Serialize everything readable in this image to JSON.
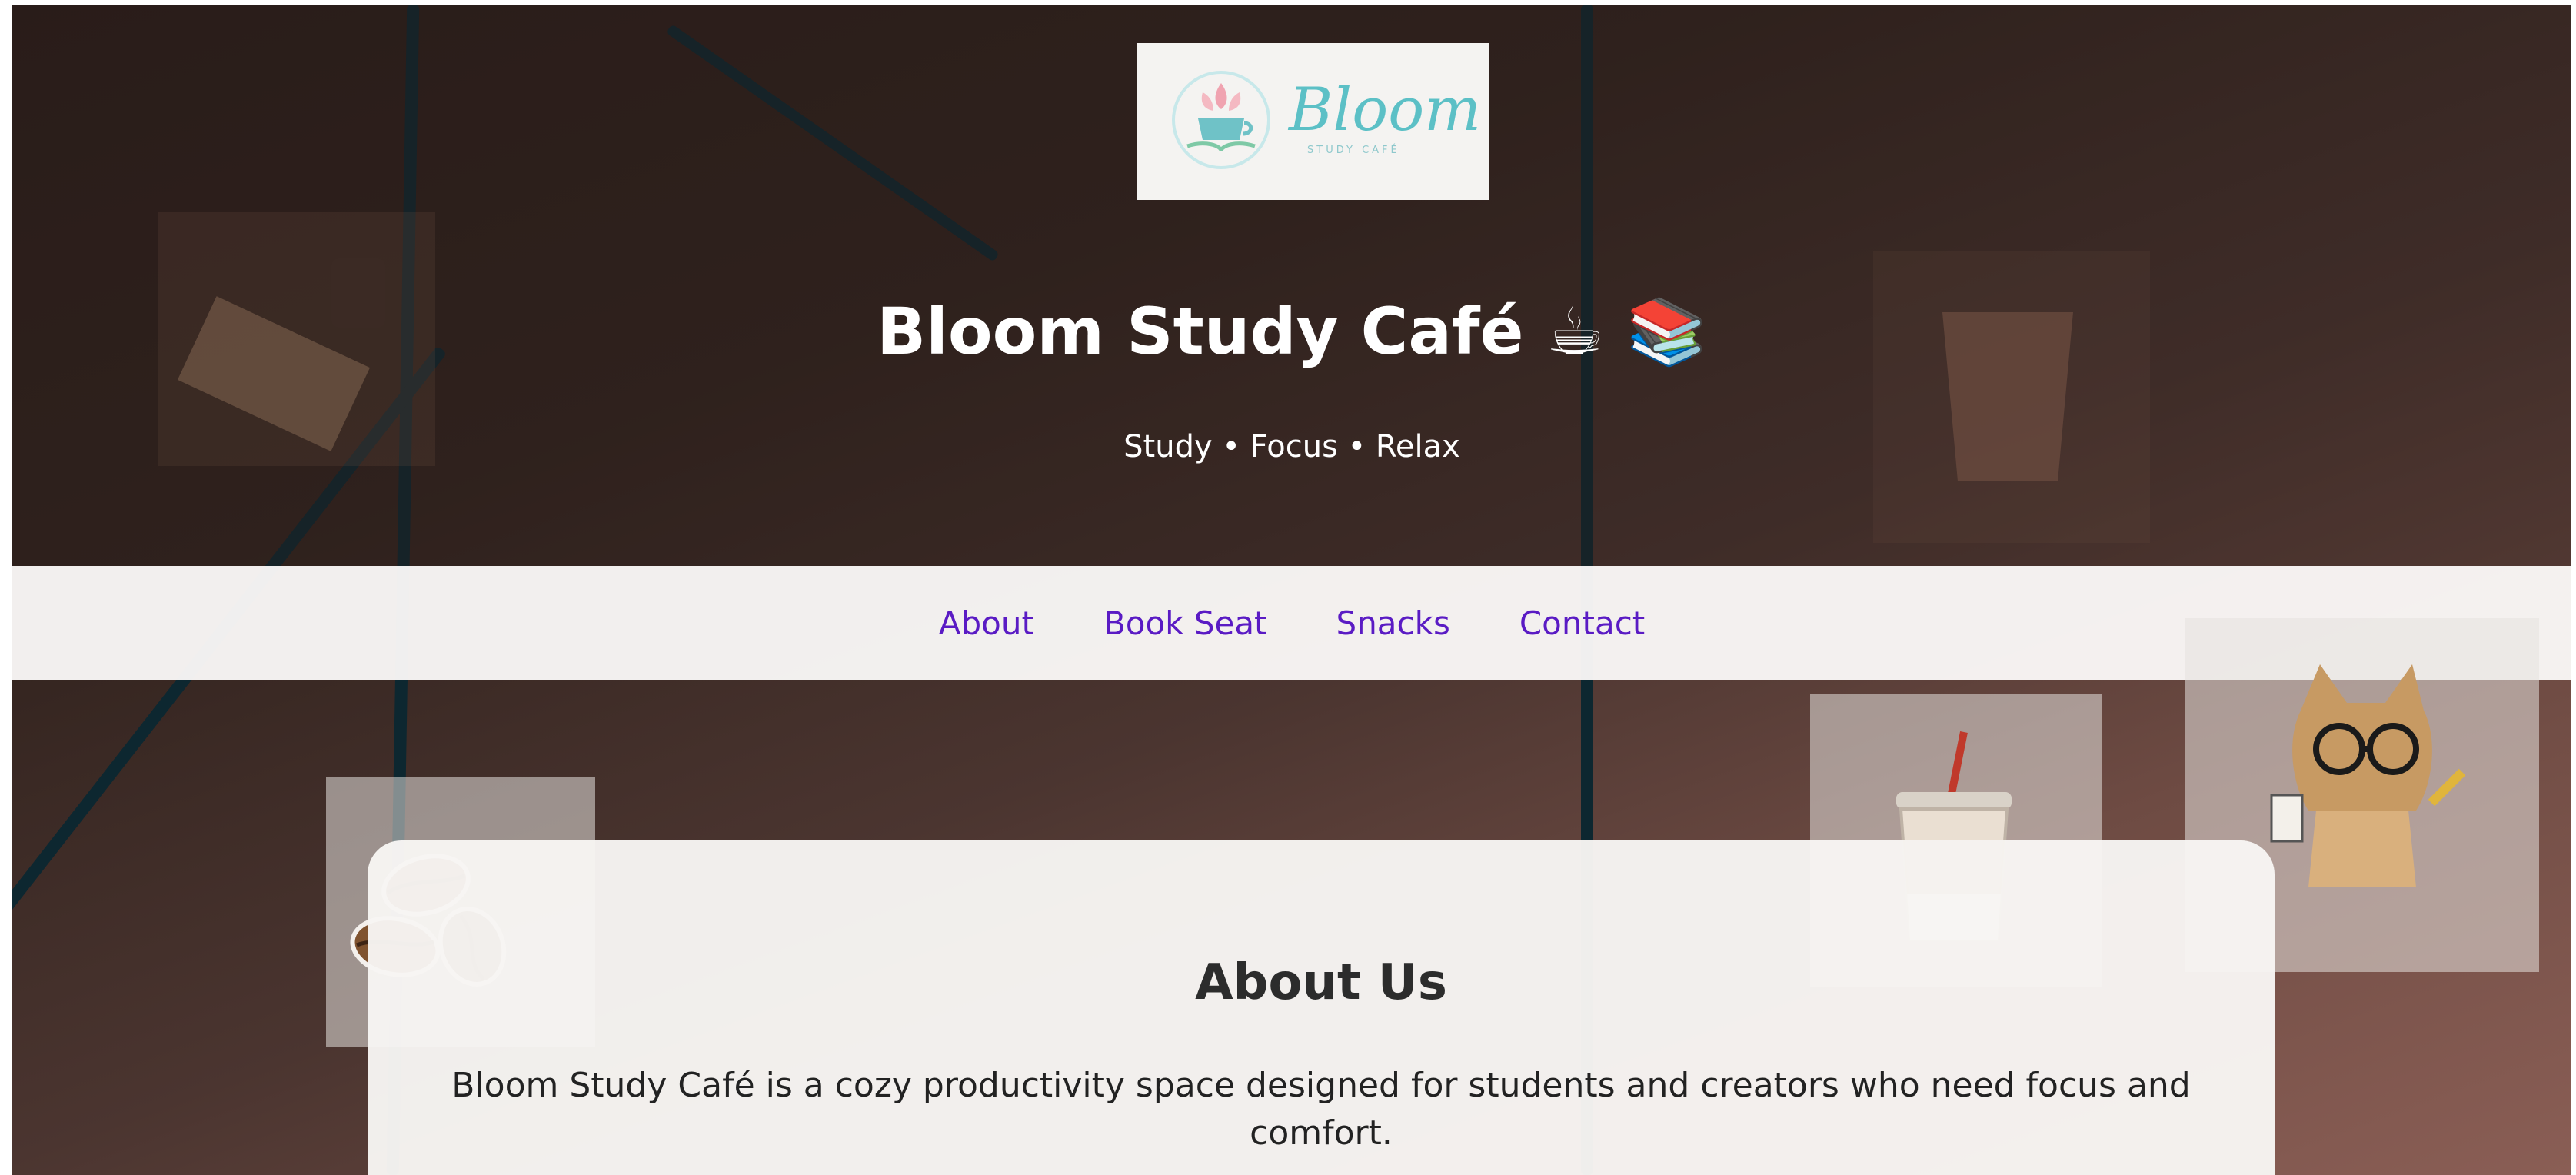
{
  "header": {
    "logo": {
      "word": "Bloom",
      "subtext": "STUDY CAFÉ",
      "accent_color": "#5cc0c6"
    },
    "title": "Bloom Study Café ☕ 📚",
    "tagline": "Study • Focus • Relax"
  },
  "nav": {
    "items": [
      {
        "label": "About"
      },
      {
        "label": "Book Seat"
      },
      {
        "label": "Snacks"
      },
      {
        "label": "Contact"
      }
    ],
    "link_color": "#5a1bc4"
  },
  "about": {
    "heading": "About Us",
    "body": "Bloom Study Café is a cozy productivity space designed for students and creators who need focus and comfort."
  },
  "decor": {
    "stickers": [
      "coffee-beans-icon",
      "iced-coffee-icon",
      "cat-with-glasses-icon",
      "iced-drink-icon",
      "coffee-cup-book-icon"
    ]
  }
}
